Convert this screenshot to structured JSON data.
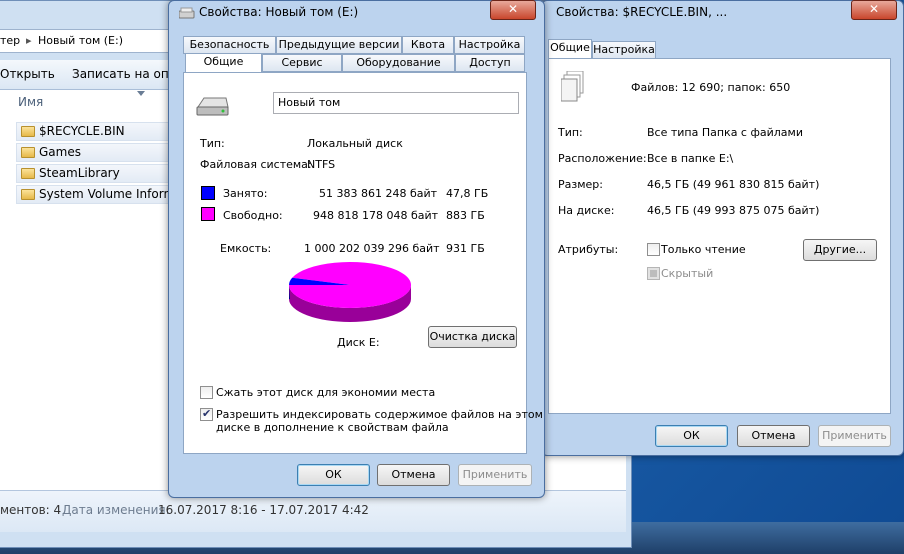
{
  "colors": {
    "used": "#0000ff",
    "free": "#ff00ff",
    "used_dark": "#00008a",
    "free_dark": "#990099"
  },
  "explorer": {
    "breadcrumb_prev": "тер",
    "breadcrumb_sep": "▸",
    "breadcrumb_current": "Новый том (E:)",
    "toolbar_open": "Открыть",
    "toolbar_share": "Записать на опти",
    "column_name": "Имя",
    "items": [
      "$RECYCLE.BIN",
      "Games",
      "SteamLibrary",
      "System Volume Informat"
    ],
    "status_count": "ментов: 4",
    "status_date_label": "Дата изменения:",
    "status_date_value": "16.07.2017 8:16 - 17.07.2017 4:42"
  },
  "disk_dialog": {
    "title": "Свойства: Новый том (E:)",
    "close": "✕",
    "tabs_row1": [
      "Безопасность",
      "Предыдущие версии",
      "Квота",
      "Настройка"
    ],
    "tabs_row2": [
      "Общие",
      "Сервис",
      "Оборудование",
      "Доступ"
    ],
    "volume_name": "Новый том",
    "type_label": "Тип:",
    "type_value": "Локальный диск",
    "fs_label": "Файловая система:",
    "fs_value": "NTFS",
    "used_label": "Занято:",
    "used_bytes": "51 383 861 248 байт",
    "used_gb": "47,8 ГБ",
    "free_label": "Свободно:",
    "free_bytes": "948 818 178 048 байт",
    "free_gb": "883 ГБ",
    "capacity_label": "Емкость:",
    "capacity_bytes": "1 000 202 039 296 байт",
    "capacity_gb": "931 ГБ",
    "used_fraction": 0.0514,
    "disk_label": "Диск E:",
    "cleanup_button": "Очистка диска",
    "compress_label": "Сжать этот диск для экономии места",
    "index_label_1": "Разрешить индексировать содержимое файлов на этом",
    "index_label_2": "диске в дополнение к свойствам файла",
    "ok": "ОК",
    "cancel": "Отмена",
    "apply": "Применить"
  },
  "recycle_dialog": {
    "title": "Свойства: $RECYCLE.BIN, ...",
    "close": "✕",
    "tabs": [
      "Общие",
      "Настройка"
    ],
    "files_summary": "Файлов: 12 690; папок: 650",
    "type_label": "Тип:",
    "type_value": "Все типа Папка с файлами",
    "location_label": "Расположение:",
    "location_value": "Все в папке E:\\",
    "size_label": "Размер:",
    "size_value": "46,5 ГБ (49 961 830 815 байт)",
    "ondisk_label": "На диске:",
    "ondisk_value": "46,5 ГБ (49 993 875 075 байт)",
    "attributes_label": "Атрибуты:",
    "readonly_label": "Только чтение",
    "hidden_label": "Скрытый",
    "other_button": "Другие...",
    "ok": "ОК",
    "cancel": "Отмена",
    "apply": "Применить"
  }
}
